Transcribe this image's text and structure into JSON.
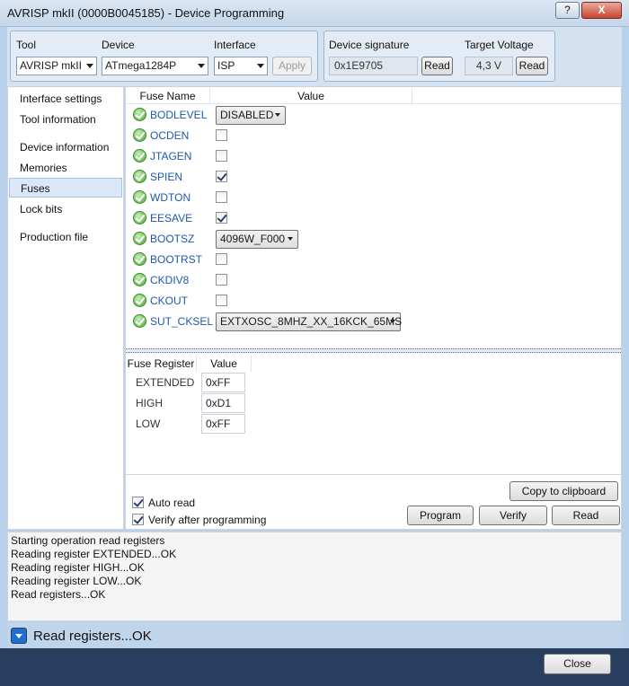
{
  "window": {
    "title": "AVRISP mkII (0000B0045185) - Device Programming",
    "help_label": "?",
    "close_label": "X"
  },
  "top": {
    "tool_label": "Tool",
    "tool_value": "AVRISP mkII",
    "device_label": "Device",
    "device_value": "ATmega1284P",
    "interface_label": "Interface",
    "interface_value": "ISP",
    "apply_label": "Apply",
    "signature_label": "Device signature",
    "signature_value": "0x1E9705",
    "signature_read_label": "Read",
    "voltage_label": "Target Voltage",
    "voltage_value": "4,3 V",
    "voltage_read_label": "Read"
  },
  "sidebar": {
    "items": [
      {
        "label": "Interface settings"
      },
      {
        "label": "Tool information"
      },
      {
        "label": "Device information"
      },
      {
        "label": "Memories"
      },
      {
        "label": "Fuses"
      },
      {
        "label": "Lock bits"
      },
      {
        "label": "Production file"
      }
    ],
    "active": "Fuses"
  },
  "fuses": {
    "col_name": "Fuse Name",
    "col_value": "Value",
    "rows": [
      {
        "name": "BODLEVEL",
        "kind": "select",
        "value": "DISABLED"
      },
      {
        "name": "OCDEN",
        "kind": "check",
        "checked": false
      },
      {
        "name": "JTAGEN",
        "kind": "check",
        "checked": false
      },
      {
        "name": "SPIEN",
        "kind": "check",
        "checked": true
      },
      {
        "name": "WDTON",
        "kind": "check",
        "checked": false
      },
      {
        "name": "EESAVE",
        "kind": "check",
        "checked": true
      },
      {
        "name": "BOOTSZ",
        "kind": "select",
        "value": "4096W_F000"
      },
      {
        "name": "BOOTRST",
        "kind": "check",
        "checked": false
      },
      {
        "name": "CKDIV8",
        "kind": "check",
        "checked": false
      },
      {
        "name": "CKOUT",
        "kind": "check",
        "checked": false
      },
      {
        "name": "SUT_CKSEL",
        "kind": "select",
        "value": "EXTXOSC_8MHZ_XX_16KCK_65MS"
      }
    ]
  },
  "registers": {
    "col_name": "Fuse Register",
    "col_value": "Value",
    "rows": [
      {
        "name": "EXTENDED",
        "value": "0xFF"
      },
      {
        "name": "HIGH",
        "value": "0xD1"
      },
      {
        "name": "LOW",
        "value": "0xFF"
      }
    ]
  },
  "actions": {
    "copy_label": "Copy to clipboard",
    "auto_read_label": "Auto read",
    "auto_read_checked": true,
    "verify_after_label": "Verify after programming",
    "verify_after_checked": true,
    "program_label": "Program",
    "verify_label": "Verify",
    "read_label": "Read"
  },
  "log": {
    "lines": [
      "Starting operation read registers",
      "Reading register EXTENDED...OK",
      "Reading register HIGH...OK",
      "Reading register LOW...OK",
      "Read registers...OK"
    ]
  },
  "status": {
    "text": "Read registers...OK"
  },
  "footer": {
    "close_label": "Close"
  }
}
